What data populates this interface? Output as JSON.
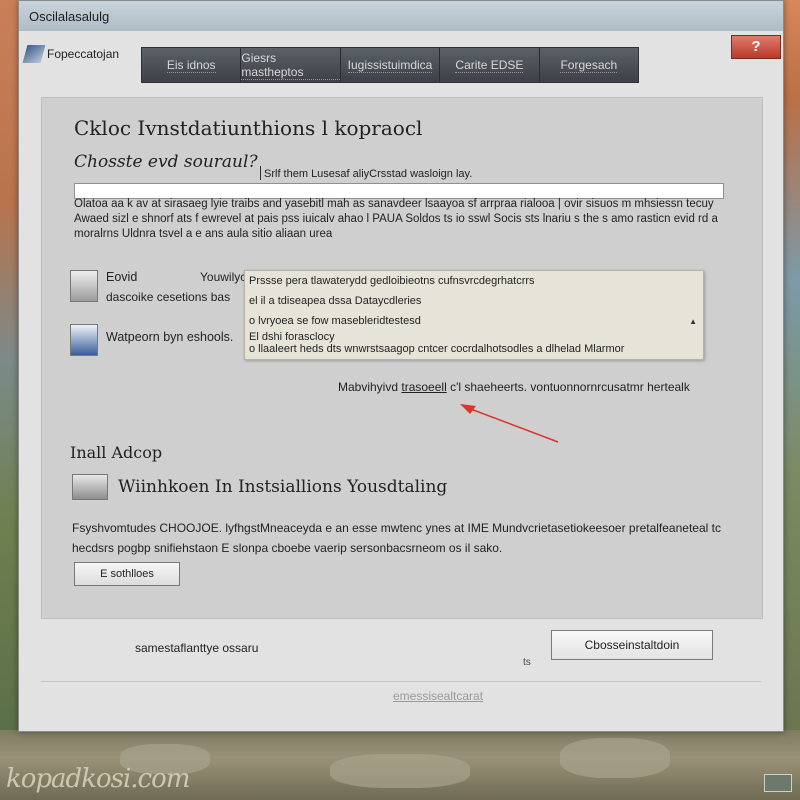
{
  "desktop": {
    "watermark": "kopadkosi.com"
  },
  "window": {
    "title": "Oscilalasalulg",
    "app_name": "Fopeccatojan",
    "close_label": "?"
  },
  "nav": {
    "tabs": [
      "Eis idnos",
      "Giesrs mastheptos",
      "Iugissistuimdica",
      "Carite EDSE",
      "Forgesach"
    ]
  },
  "main": {
    "heading": "Ckloc Ivnstdatiunthions l kopraocl",
    "subheading": "Chosste evd souraul?",
    "hint": "Srlf them Lusesaf aliyCrsstad wasloign lay.",
    "path_value": "",
    "description": "Olatoa aa k av at sirasaeg lyie traibs and yasebitl mah as sanavdeer lsaayoa sf arrpraa rialooa | ovir sisuos m mhsiessn tecuy Awaed sizl e shnorf ats f ewrevel at pais pss iuicalv ahao l PAUA Soldos ts io sswl Socis sts lnariu s the s amo rasticn evid rd a moralrns Uldnra tsvel a e ans  aula sitio aliaan urea",
    "option1_label": "Eovid",
    "option1_sub": "dascoike cesetions bas",
    "option2_label": "Watpeorn byn eshools.",
    "you_label": "Youwilyc",
    "dropdown": {
      "items": [
        "Prssse pera tlawaterydd gedloibieotns cufnsvrcdegrhatcrrs",
        "el il a tdiseapea dssa Dataycdleries",
        "o lvryoea se fow masebleridtestesd",
        "El dshi forasclocy",
        "o llaaleert heds dts wnwrstsaagop cntcer cocrdalhotsodles a dlhelad Mlarmor"
      ]
    },
    "link_prefix": "Mabvihyivd",
    "link_text": "trasoeell",
    "link_suffix": "c'l shaeheerts. vontuonnornrcusatmr hertealk",
    "install_heading": "Inall Adcop",
    "install_label": "Wiinhkoen In Instsiallions Yousdtaling",
    "install_desc": "Fsyshvomtudes  CHOOJOE. lyfhgstMneaceyda e an esse mwtenc ynes at IME Mundvcrietasetiokeesoer pretalfeaneteal tc hecdsrs pogbp snifiehstaon E slonpa cboebe vaerip sersonbacsrneom os il sako.",
    "small_button": "E sothlloes"
  },
  "footer": {
    "note": "samestaflanttye ossaru",
    "mini": "ts",
    "primary_button": "Cbosseinstaltdoin",
    "link": "emessisealtcarat"
  }
}
